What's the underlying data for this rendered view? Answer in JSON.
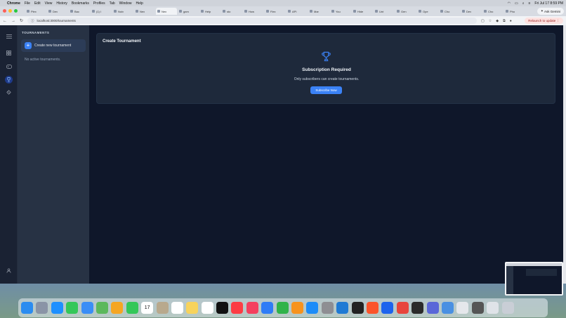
{
  "menubar": {
    "app": "Chrome",
    "items": [
      "File",
      "Edit",
      "View",
      "History",
      "Bookmarks",
      "Profiles",
      "Tab",
      "Window",
      "Help"
    ],
    "clock": "Fri Jul 17  8:59 PM"
  },
  "tabs": [
    {
      "label": "Plex"
    },
    {
      "label": "Dev"
    },
    {
      "label": "Bac"
    },
    {
      "label": "(1) I"
    },
    {
      "label": "Nolv"
    },
    {
      "label": "Nex"
    },
    {
      "label": "Nex",
      "active": true
    },
    {
      "label": "gam"
    },
    {
      "label": "Help"
    },
    {
      "label": "sto"
    },
    {
      "label": "How"
    },
    {
      "label": "Flex"
    },
    {
      "label": "API"
    },
    {
      "label": "Mar"
    },
    {
      "label": "You"
    },
    {
      "label": "Hide"
    },
    {
      "label": "Unt"
    },
    {
      "label": "Gen"
    },
    {
      "label": "Ope"
    },
    {
      "label": "Cho"
    },
    {
      "label": "Dev"
    },
    {
      "label": "Cho"
    },
    {
      "label": "Pho"
    }
  ],
  "browser": {
    "ask_label": "Ask Gemini",
    "url": "localhost:3000/tournaments",
    "relaunch_label": "Relaunch to update"
  },
  "sidebar": {
    "title": "TOURNAMENTS",
    "create_label": "Create new tournament",
    "empty_text": "No active tournaments."
  },
  "main": {
    "card_title": "Create Tournament",
    "sub_title": "Subscription Required",
    "sub_desc": "Only subscribers can create tournaments.",
    "sub_button": "Subscribe Now"
  },
  "colors": {
    "accent": "#3b82f6",
    "background": "#0f172a",
    "card": "#1e293b",
    "panel": "#273244"
  },
  "dock": {
    "calendar_day": "17",
    "apps": [
      {
        "name": "finder",
        "color": "#2b8cf0"
      },
      {
        "name": "launchpad",
        "color": "#8a94a6"
      },
      {
        "name": "safari",
        "color": "#1e90ff"
      },
      {
        "name": "messages",
        "color": "#34c759"
      },
      {
        "name": "mail",
        "color": "#3a8ef6"
      },
      {
        "name": "maps",
        "color": "#5cb85c"
      },
      {
        "name": "photos",
        "color": "#f5a623"
      },
      {
        "name": "facetime",
        "color": "#34c759"
      },
      {
        "name": "calendar",
        "color": "#ffffff"
      },
      {
        "name": "contacts",
        "color": "#b8a98d"
      },
      {
        "name": "reminders",
        "color": "#ffffff"
      },
      {
        "name": "notes",
        "color": "#f7d35c"
      },
      {
        "name": "freeform",
        "color": "#ffffff"
      },
      {
        "name": "tv",
        "color": "#111111"
      },
      {
        "name": "music",
        "color": "#fc3c44"
      },
      {
        "name": "news",
        "color": "#f43f5e"
      },
      {
        "name": "keynote",
        "color": "#2f7cf6"
      },
      {
        "name": "numbers",
        "color": "#30b34a"
      },
      {
        "name": "pages",
        "color": "#f7931e"
      },
      {
        "name": "app-store",
        "color": "#1d8cf8"
      },
      {
        "name": "system-settings",
        "color": "#8e8e93"
      },
      {
        "name": "vscode",
        "color": "#1f7ad4"
      },
      {
        "name": "terminal",
        "color": "#222222"
      },
      {
        "name": "brave",
        "color": "#fb542b"
      },
      {
        "name": "docker",
        "color": "#1d63ed"
      },
      {
        "name": "chrome",
        "color": "#e8453c"
      },
      {
        "name": "window-app",
        "color": "#2b2b2b"
      },
      {
        "name": "arc",
        "color": "#5a67d8"
      },
      {
        "name": "preview",
        "color": "#4a90e2"
      },
      {
        "name": "textedit",
        "color": "#e5e7eb"
      },
      {
        "name": "calculator",
        "color": "#555555"
      },
      {
        "name": "downloads",
        "color": "#dfe3e8"
      },
      {
        "name": "trash",
        "color": "#c9ced6"
      }
    ]
  }
}
